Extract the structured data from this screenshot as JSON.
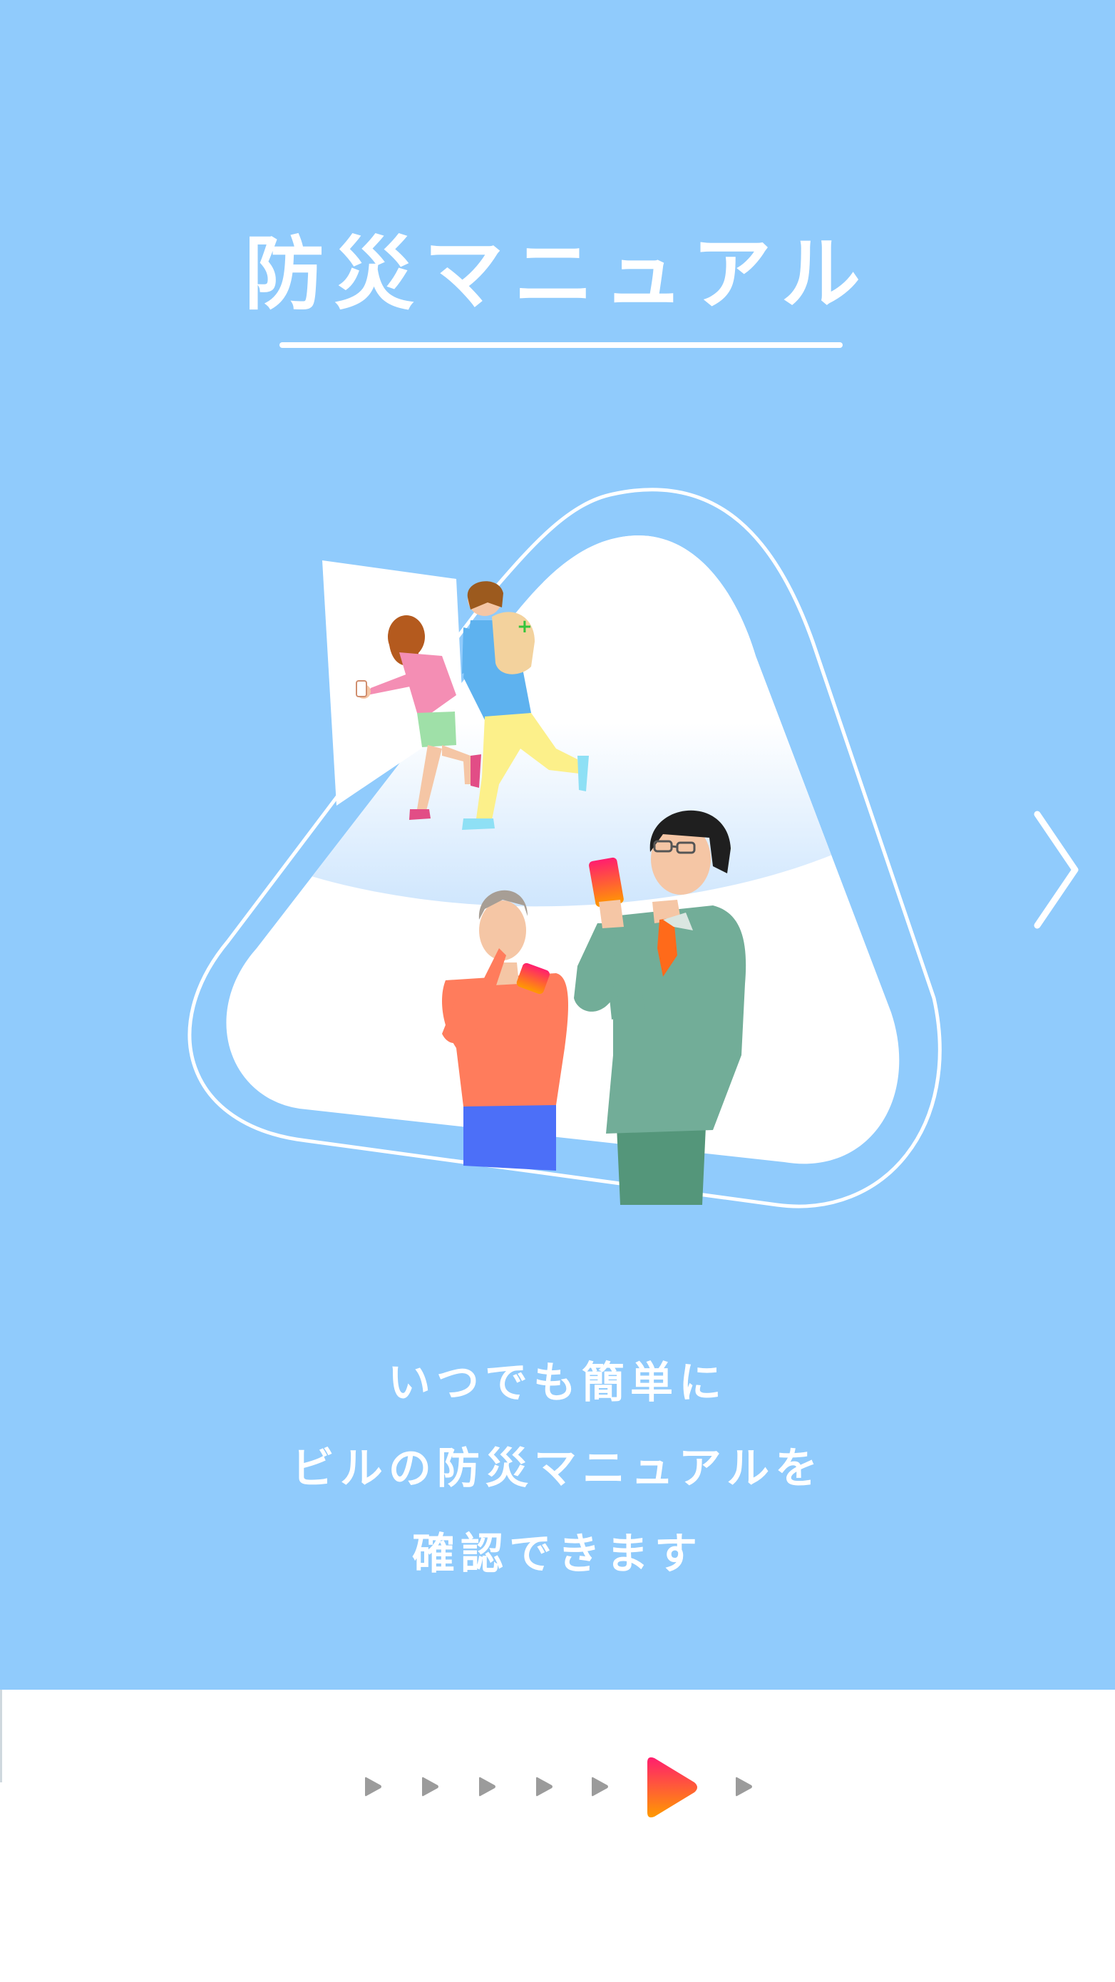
{
  "title": "防災マニュアル",
  "description": {
    "line1": "いつでも簡単に",
    "line2": "ビルの防災マニュアルを",
    "line3": "確認できます"
  },
  "navigation": {
    "next_icon": "chevron-right-icon"
  },
  "pager": {
    "total_pages": 7,
    "current_page": 6
  },
  "colors": {
    "background": "#90cbfc",
    "accent_gradient_start": "#ff1e6e",
    "accent_gradient_end": "#ff9a00",
    "inactive_dot": "#9b9b9b"
  }
}
